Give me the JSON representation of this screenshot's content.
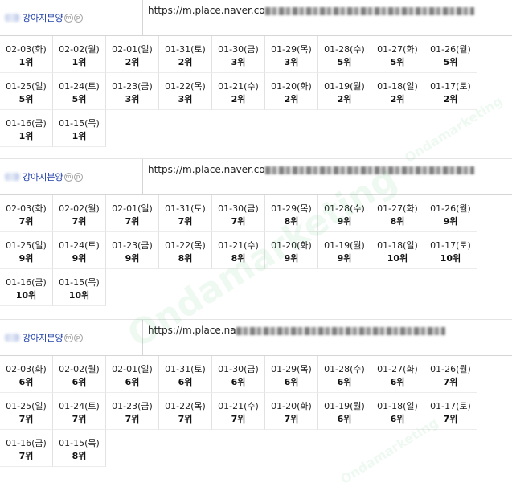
{
  "url_prefix": "https://m.place.naver.co",
  "watermark_text": "Ondamarketing",
  "blocks": [
    {
      "keyword": "강아지분양",
      "badge_m": "m",
      "badge_p": "p",
      "url_visible": "https://m.place.naver.co",
      "rows": [
        [
          {
            "d": "02-03(화)",
            "r": "1위"
          },
          {
            "d": "02-02(월)",
            "r": "1위"
          },
          {
            "d": "02-01(일)",
            "r": "2위"
          },
          {
            "d": "01-31(토)",
            "r": "2위"
          },
          {
            "d": "01-30(금)",
            "r": "3위"
          },
          {
            "d": "01-29(목)",
            "r": "3위"
          },
          {
            "d": "01-28(수)",
            "r": "5위"
          },
          {
            "d": "01-27(화)",
            "r": "5위"
          },
          {
            "d": "01-26(월)",
            "r": "5위"
          }
        ],
        [
          {
            "d": "01-25(일)",
            "r": "5위"
          },
          {
            "d": "01-24(토)",
            "r": "5위"
          },
          {
            "d": "01-23(금)",
            "r": "3위"
          },
          {
            "d": "01-22(목)",
            "r": "3위"
          },
          {
            "d": "01-21(수)",
            "r": "2위"
          },
          {
            "d": "01-20(화)",
            "r": "2위"
          },
          {
            "d": "01-19(월)",
            "r": "2위"
          },
          {
            "d": "01-18(일)",
            "r": "2위"
          },
          {
            "d": "01-17(토)",
            "r": "2위"
          }
        ],
        [
          {
            "d": "01-16(금)",
            "r": "1위"
          },
          {
            "d": "01-15(목)",
            "r": "1위"
          }
        ]
      ]
    },
    {
      "keyword": "강아지분양",
      "badge_m": "m",
      "badge_p": "p",
      "url_visible": "https://m.place.naver.co",
      "rows": [
        [
          {
            "d": "02-03(화)",
            "r": "7위"
          },
          {
            "d": "02-02(월)",
            "r": "7위"
          },
          {
            "d": "02-01(일)",
            "r": "7위"
          },
          {
            "d": "01-31(토)",
            "r": "7위"
          },
          {
            "d": "01-30(금)",
            "r": "7위"
          },
          {
            "d": "01-29(목)",
            "r": "8위"
          },
          {
            "d": "01-28(수)",
            "r": "9위"
          },
          {
            "d": "01-27(화)",
            "r": "8위"
          },
          {
            "d": "01-26(월)",
            "r": "9위"
          }
        ],
        [
          {
            "d": "01-25(일)",
            "r": "9위"
          },
          {
            "d": "01-24(토)",
            "r": "9위"
          },
          {
            "d": "01-23(금)",
            "r": "9위"
          },
          {
            "d": "01-22(목)",
            "r": "8위"
          },
          {
            "d": "01-21(수)",
            "r": "8위"
          },
          {
            "d": "01-20(화)",
            "r": "9위"
          },
          {
            "d": "01-19(월)",
            "r": "9위"
          },
          {
            "d": "01-18(일)",
            "r": "10위"
          },
          {
            "d": "01-17(토)",
            "r": "10위"
          }
        ],
        [
          {
            "d": "01-16(금)",
            "r": "10위"
          },
          {
            "d": "01-15(목)",
            "r": "10위"
          }
        ]
      ]
    },
    {
      "keyword": "강아지분양",
      "badge_m": "m",
      "badge_p": "p",
      "url_visible": "https://m.place.na",
      "rows": [
        [
          {
            "d": "02-03(화)",
            "r": "6위"
          },
          {
            "d": "02-02(월)",
            "r": "6위"
          },
          {
            "d": "02-01(일)",
            "r": "6위"
          },
          {
            "d": "01-31(토)",
            "r": "6위"
          },
          {
            "d": "01-30(금)",
            "r": "6위"
          },
          {
            "d": "01-29(목)",
            "r": "6위"
          },
          {
            "d": "01-28(수)",
            "r": "6위"
          },
          {
            "d": "01-27(화)",
            "r": "6위"
          },
          {
            "d": "01-26(월)",
            "r": "7위"
          }
        ],
        [
          {
            "d": "01-25(일)",
            "r": "7위"
          },
          {
            "d": "01-24(토)",
            "r": "7위"
          },
          {
            "d": "01-23(금)",
            "r": "7위"
          },
          {
            "d": "01-22(목)",
            "r": "7위"
          },
          {
            "d": "01-21(수)",
            "r": "7위"
          },
          {
            "d": "01-20(화)",
            "r": "7위"
          },
          {
            "d": "01-19(월)",
            "r": "6위"
          },
          {
            "d": "01-18(일)",
            "r": "6위"
          },
          {
            "d": "01-17(토)",
            "r": "7위"
          }
        ],
        [
          {
            "d": "01-16(금)",
            "r": "7위"
          },
          {
            "d": "01-15(목)",
            "r": "8위"
          }
        ]
      ]
    }
  ]
}
